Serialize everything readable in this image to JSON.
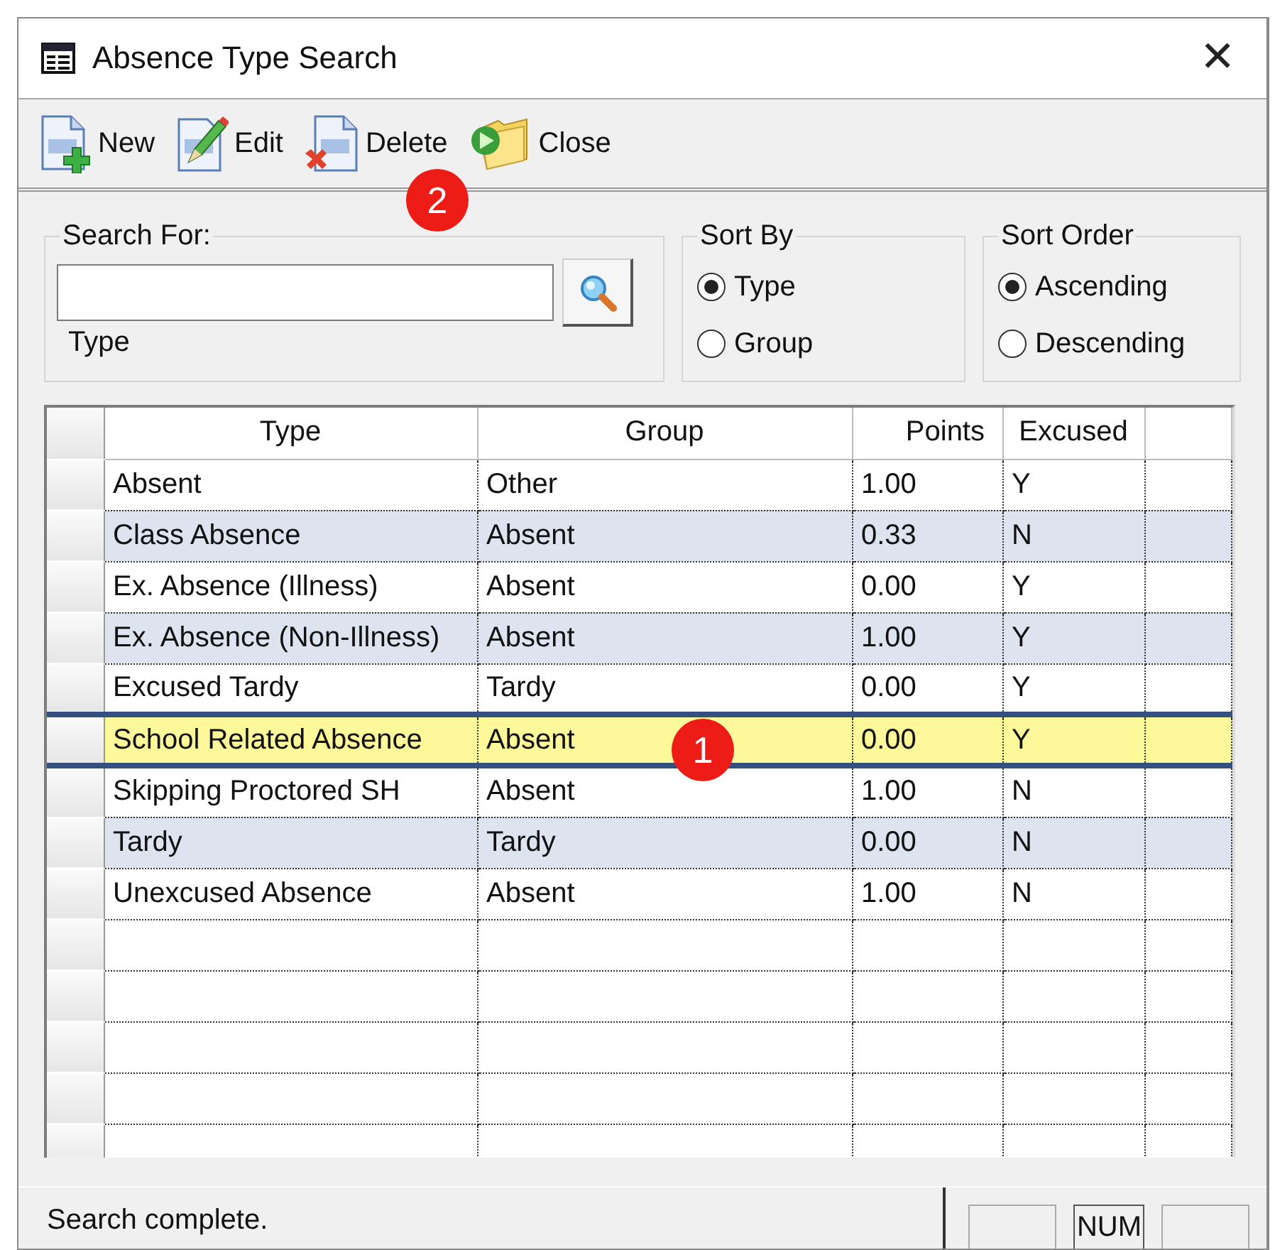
{
  "window": {
    "title": "Absence Type Search",
    "close_glyph": "✕"
  },
  "toolbar": [
    {
      "kind": "new",
      "label": "New"
    },
    {
      "kind": "edit",
      "label": "Edit"
    },
    {
      "kind": "delete",
      "label": "Delete"
    },
    {
      "kind": "close",
      "label": "Close"
    }
  ],
  "search": {
    "legend": "Search For:",
    "field_label": "Type"
  },
  "sort_by": {
    "legend": "Sort By",
    "options": [
      {
        "label": "Type",
        "selected": true
      },
      {
        "label": "Group",
        "selected": false
      }
    ]
  },
  "sort_order": {
    "legend": "Sort Order",
    "options": [
      {
        "label": "Ascending",
        "selected": true
      },
      {
        "label": "Descending",
        "selected": false
      }
    ]
  },
  "table": {
    "columns": [
      "Type",
      "Group",
      "Points",
      "Excused"
    ],
    "rows": [
      {
        "cells": [
          "Absent",
          "Other",
          "1.00",
          "Y"
        ],
        "selected": false
      },
      {
        "cells": [
          "Class Absence",
          "Absent",
          "0.33",
          "N"
        ],
        "selected": false
      },
      {
        "cells": [
          "Ex. Absence (Illness)",
          "Absent",
          "0.00",
          "Y"
        ],
        "selected": false
      },
      {
        "cells": [
          "Ex. Absence (Non-Illness)",
          "Absent",
          "1.00",
          "Y"
        ],
        "selected": false
      },
      {
        "cells": [
          "Excused Tardy",
          "Tardy",
          "0.00",
          "Y"
        ],
        "selected": false
      },
      {
        "cells": [
          "School Related Absence",
          "Absent",
          "0.00",
          "Y"
        ],
        "selected": true
      },
      {
        "cells": [
          "Skipping Proctored SH",
          "Absent",
          "1.00",
          "N"
        ],
        "selected": false
      },
      {
        "cells": [
          "Tardy",
          "Tardy",
          "0.00",
          "N"
        ],
        "selected": false
      },
      {
        "cells": [
          "Unexcused Absence",
          "Absent",
          "1.00",
          "N"
        ],
        "selected": false
      }
    ]
  },
  "status_bar": {
    "message": "Search complete.",
    "indicators": [
      "NUM"
    ]
  },
  "callouts": [
    {
      "label": "1"
    },
    {
      "label": "2"
    }
  ]
}
